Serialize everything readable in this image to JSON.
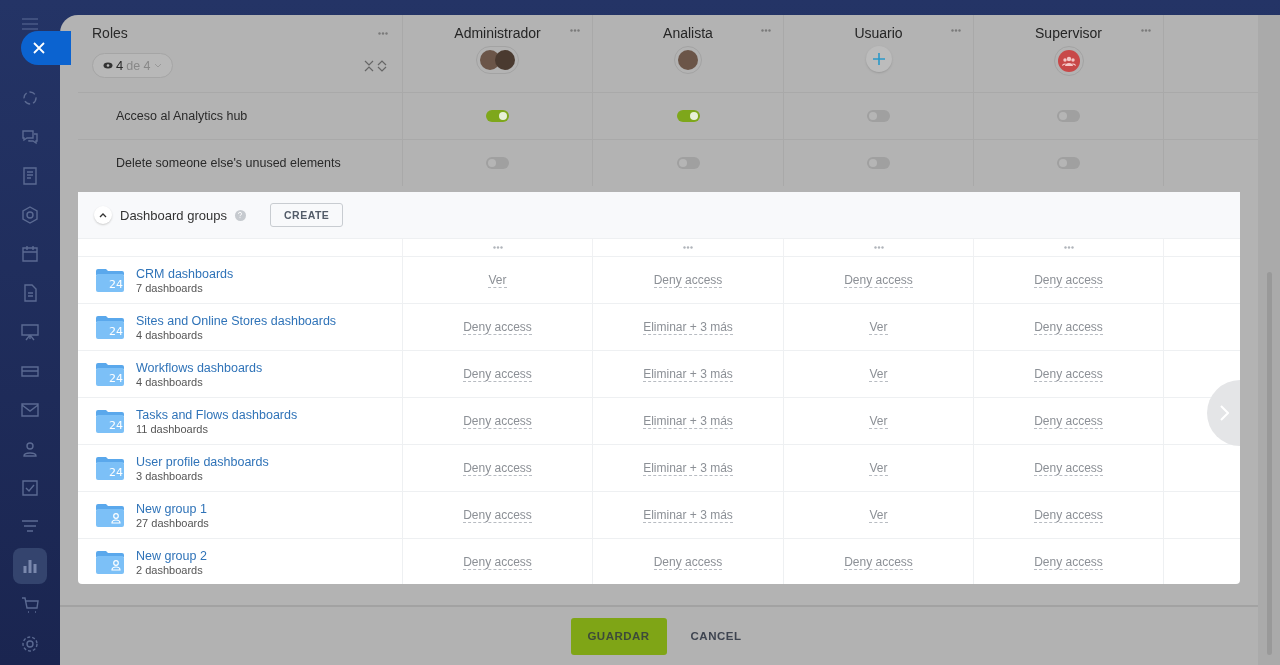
{
  "sidebar": {
    "items": [
      {
        "selected": false
      },
      {
        "selected": false
      },
      {
        "selected": false
      },
      {
        "selected": false
      },
      {
        "selected": false
      },
      {
        "selected": false
      },
      {
        "selected": false
      },
      {
        "selected": false
      },
      {
        "selected": false
      },
      {
        "selected": false
      },
      {
        "selected": false
      },
      {
        "selected": false
      },
      {
        "selected": true
      },
      {
        "selected": false
      },
      {
        "selected": false
      }
    ]
  },
  "roles_header": {
    "title": "Roles",
    "filter": {
      "shown": "4",
      "total": "de 4"
    }
  },
  "roles": [
    {
      "name": "Administrador",
      "kind": "pair"
    },
    {
      "name": "Analista",
      "kind": "single"
    },
    {
      "name": "Usuario",
      "kind": "add"
    },
    {
      "name": "Supervisor",
      "kind": "group"
    }
  ],
  "permissions": [
    {
      "label": "Acceso al Analytics hub",
      "values": [
        {
          "on": true
        },
        {
          "on": true
        },
        {
          "on": false
        },
        {
          "on": false
        }
      ]
    },
    {
      "label": "Delete someone else's unused elements",
      "values": [
        {
          "on": false
        },
        {
          "on": false
        },
        {
          "on": false
        },
        {
          "on": false
        }
      ]
    }
  ],
  "dashboard_groups": {
    "title": "Dashboard groups",
    "expanded": true,
    "create_button": "CREATE",
    "rows": [
      {
        "name": "CRM dashboards",
        "count": "7 dashboards",
        "kind": "system",
        "icon_label": "24",
        "cells": [
          "Ver",
          "Deny access",
          "Deny access",
          "Deny access"
        ]
      },
      {
        "name": "Sites and Online Stores dashboards",
        "count": "4 dashboards",
        "kind": "system",
        "icon_label": "24",
        "cells": [
          "Deny access",
          "Eliminar + 3 más",
          "Ver",
          "Deny access"
        ]
      },
      {
        "name": "Workflows dashboards",
        "count": "4 dashboards",
        "kind": "system",
        "icon_label": "24",
        "cells": [
          "Deny access",
          "Eliminar + 3 más",
          "Ver",
          "Deny access"
        ]
      },
      {
        "name": "Tasks and Flows dashboards",
        "count": "11 dashboards",
        "kind": "system",
        "icon_label": "24",
        "cells": [
          "Deny access",
          "Eliminar + 3 más",
          "Ver",
          "Deny access"
        ]
      },
      {
        "name": "User profile dashboards",
        "count": "3 dashboards",
        "kind": "system",
        "icon_label": "24",
        "cells": [
          "Deny access",
          "Eliminar + 3 más",
          "Ver",
          "Deny access"
        ]
      },
      {
        "name": "New group 1",
        "count": "27 dashboards",
        "kind": "custom",
        "cells": [
          "Deny access",
          "Eliminar + 3 más",
          "Ver",
          "Deny access"
        ]
      },
      {
        "name": "New group 2",
        "count": "2 dashboards",
        "kind": "custom",
        "cells": [
          "Deny access",
          "Deny access",
          "Deny access",
          "Deny access"
        ]
      }
    ]
  },
  "footer": {
    "buttons": [
      "GUARDAR",
      "CANCEL"
    ]
  }
}
